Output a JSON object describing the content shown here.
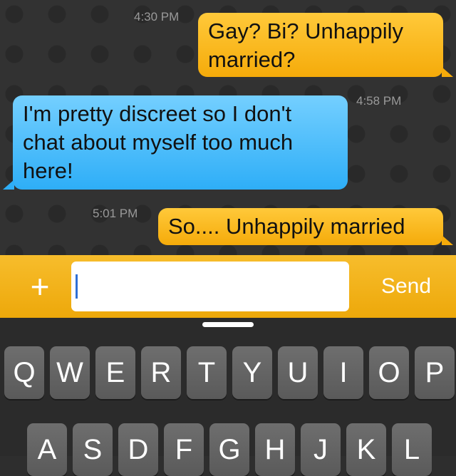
{
  "messages": [
    {
      "direction": "outgoing",
      "time": "4:30 PM",
      "lines": [
        "Gay? Bi? Unhappily",
        "married?"
      ]
    },
    {
      "direction": "incoming",
      "time": "4:58 PM",
      "lines": [
        "I'm pretty discreet so I don't",
        "chat about myself too much",
        "here!"
      ]
    },
    {
      "direction": "outgoing",
      "time": "5:01 PM",
      "lines": [
        "So.... Unhappily married"
      ]
    }
  ],
  "compose": {
    "add_label": "+",
    "input_value": "",
    "send_label": "Send"
  },
  "keyboard": {
    "row1": [
      "Q",
      "W",
      "E",
      "R",
      "T",
      "Y",
      "U",
      "I",
      "O",
      "P"
    ],
    "row2": [
      "A",
      "S",
      "D",
      "F",
      "G",
      "H",
      "J",
      "K",
      "L"
    ]
  },
  "colors": {
    "outgoing_bubble": "#f5ab0a",
    "incoming_bubble": "#2eaef7",
    "compose_bar": "#f7bd2c",
    "background": "#323232"
  }
}
